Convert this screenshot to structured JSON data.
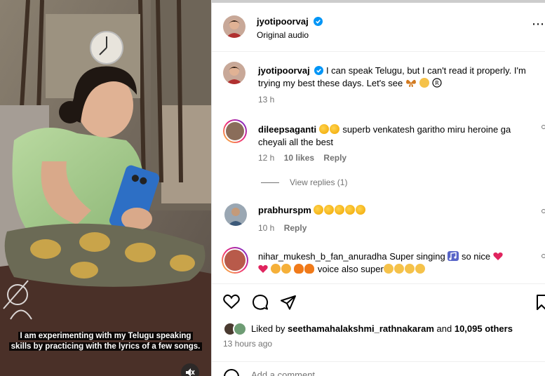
{
  "post": {
    "author": "jyotipoorvaj",
    "audio": "Original audio",
    "caption": "I can speak Telugu, but I can't read it properly. I'm trying my best these days. Let's see",
    "caption_time": "13 h"
  },
  "video": {
    "subtitle_line1": "I am experimenting with my Telugu speaking",
    "subtitle_line2": "skills by practicing with the lyrics of a few songs."
  },
  "comments": [
    {
      "user": "dileepsaganti",
      "text": "superb venkatesh garitho miru heroine ga cheyali all the best",
      "time": "12 h",
      "likes": "10 likes",
      "reply_label": "Reply",
      "view_replies": "View replies (1)"
    },
    {
      "user": "prabhurspm",
      "time": "10 h",
      "reply_label": "Reply"
    },
    {
      "user": "nihar_mukesh_b_fan_anuradha",
      "text_part1": "Super singing",
      "text_part2": "so nice",
      "text_part3": "voice also super"
    }
  ],
  "likes": {
    "prefix": "Liked by",
    "user": "seethamahalakshmi_rathnakaram",
    "and": "and",
    "others": "10,095 others"
  },
  "timestamp": "13 hours ago",
  "comment_input": {
    "placeholder": "Add a comment..."
  },
  "icons": {
    "more": "more-options-icon",
    "like": "heart-icon",
    "comment": "comment-icon",
    "share": "share-icon",
    "save": "bookmark-icon",
    "mute": "muted-speaker-icon",
    "verified": "verified-badge-icon"
  },
  "colors": {
    "verified": "#0095f6",
    "heart": "#ed4956",
    "muted_text": "#737373"
  }
}
